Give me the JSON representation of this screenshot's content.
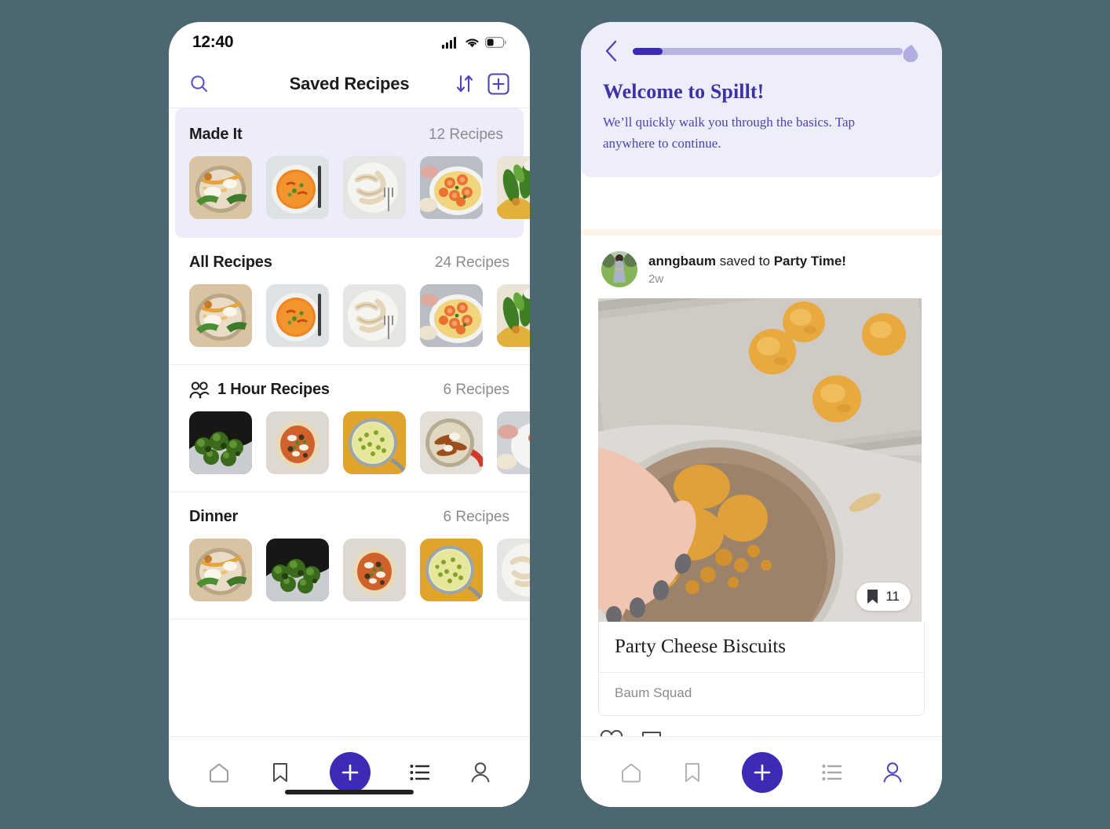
{
  "canvas": {
    "background": "#4d6770"
  },
  "theme": {
    "primary": "#3b2bb5",
    "accent_light": "#ececfa",
    "welcome_bg": "#eeeefb",
    "cream": "#fdf3e8"
  },
  "left_phone": {
    "status_bar": {
      "time": "12:40",
      "icons": [
        "cellular-signal-icon",
        "wifi-icon",
        "battery-icon"
      ]
    },
    "header": {
      "title": "Saved Recipes",
      "search_icon": "search-icon",
      "sort_icon": "sort-arrows-icon",
      "add_icon": "add-box-icon"
    },
    "sections": [
      {
        "title": "Made It",
        "count": "12 Recipes",
        "highlighted": true,
        "icon": null,
        "thumbs": [
          "noodle-bowl",
          "tomato-soup",
          "pasta-fettuccine",
          "shrimp-plate",
          "greens-plate"
        ]
      },
      {
        "title": "All Recipes",
        "count": "24 Recipes",
        "highlighted": false,
        "icon": null,
        "thumbs": [
          "noodle-bowl",
          "tomato-soup",
          "pasta-fettuccine",
          "shrimp-plate",
          "greens-plate"
        ]
      },
      {
        "title": "1 Hour Recipes",
        "count": "6 Recipes",
        "highlighted": false,
        "icon": "group-people-icon",
        "thumbs": [
          "charred-broccoli",
          "flatbread-pizza",
          "pistachio-soup",
          "skillet-bake",
          "shrimp-plate"
        ]
      },
      {
        "title": "Dinner",
        "count": "6 Recipes",
        "highlighted": false,
        "icon": null,
        "thumbs": [
          "noodle-bowl",
          "charred-broccoli",
          "flatbread-pizza",
          "pistachio-soup",
          "pasta-fettuccine"
        ]
      }
    ],
    "tabbar": {
      "items": [
        {
          "name": "home-icon",
          "active": false
        },
        {
          "name": "bookmark-icon",
          "active": false
        },
        {
          "name": "plus-icon",
          "active": true
        },
        {
          "name": "list-icon",
          "active": false
        },
        {
          "name": "profile-icon",
          "active": false
        }
      ]
    }
  },
  "right_phone": {
    "welcome": {
      "back_icon": "chevron-left-icon",
      "progress_percent": 12,
      "title": "Welcome to Spillt!",
      "subtitle": "We’ll quickly walk you through the basics. Tap anywhere to continue."
    },
    "post": {
      "avatar": "user-avatar",
      "username": "anngbaum",
      "action_text": "saved to",
      "collection": "Party Time!",
      "time": "2w",
      "photo": "cheese-biscuit-dough-photo",
      "save_badge": {
        "icon": "bookmark-filled-icon",
        "count": "11"
      },
      "recipe_title": "Party Cheese Biscuits",
      "recipe_source": "Baum Squad",
      "actions": [
        {
          "name": "like-heart-icon"
        },
        {
          "name": "comment-bubble-icon"
        }
      ]
    },
    "tabbar": {
      "items": [
        {
          "name": "home-icon",
          "active": false
        },
        {
          "name": "bookmark-icon",
          "active": false
        },
        {
          "name": "plus-icon",
          "active": true
        },
        {
          "name": "list-icon",
          "active": false
        },
        {
          "name": "profile-icon",
          "active": true
        }
      ]
    }
  }
}
